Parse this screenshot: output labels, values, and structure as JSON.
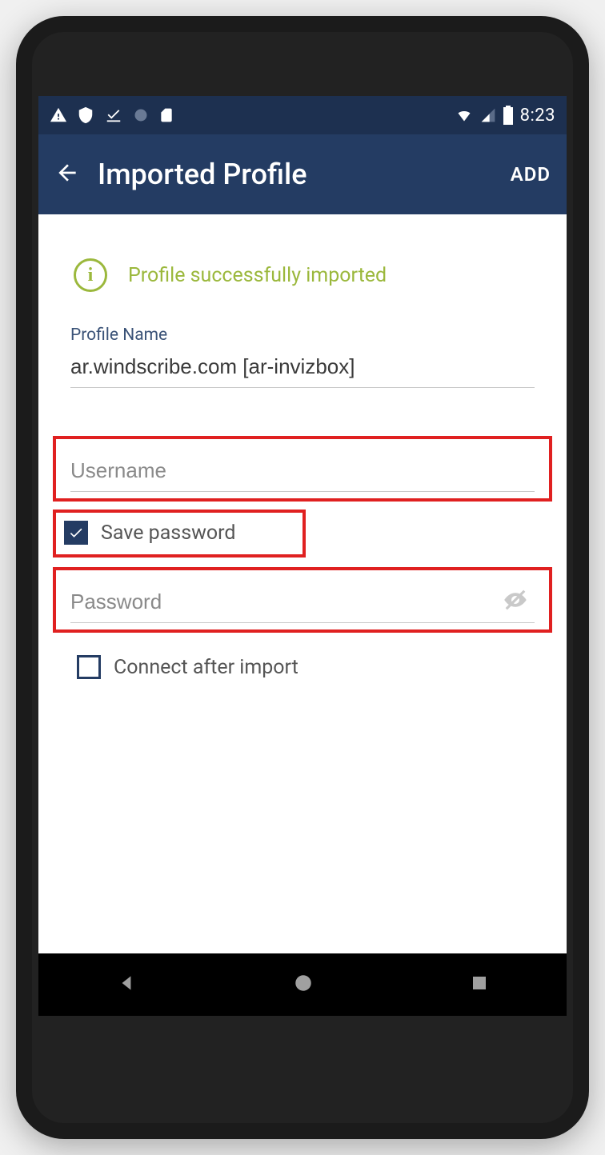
{
  "statusbar": {
    "time": "8:23"
  },
  "appbar": {
    "title": "Imported Profile",
    "action": "ADD"
  },
  "success": {
    "message": "Profile successfully imported"
  },
  "form": {
    "profile_name_label": "Profile Name",
    "profile_name_value": "ar.windscribe.com [ar-invizbox]",
    "username_placeholder": "Username",
    "username_value": "",
    "save_password_label": "Save password",
    "save_password_checked": true,
    "password_placeholder": "Password",
    "password_value": "",
    "connect_after_label": "Connect after import",
    "connect_after_checked": false
  },
  "colors": {
    "primary": "#243c63",
    "status_dark": "#1d3050",
    "accent_green": "#9bb83c",
    "highlight_red": "#e02020"
  }
}
